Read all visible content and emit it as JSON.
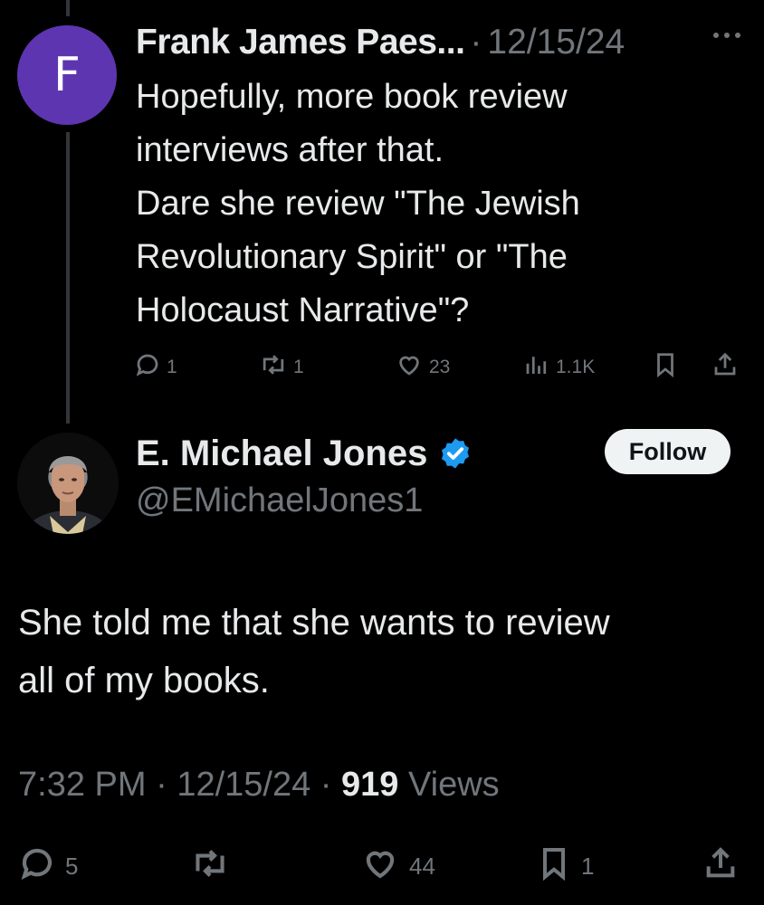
{
  "reply": {
    "avatar_letter": "F",
    "avatar_color": "#5e35b1",
    "author_name": "Frank James Paes...",
    "separator": "·",
    "date": "12/15/24",
    "more_icon": "more-horizontal-icon",
    "body_lines": [
      "Hopefully, more book review",
      "interviews after that.",
      "Dare she review \"The Jewish",
      "Revolutionary Spirit\" or \"The",
      "Holocaust Narrative\"?"
    ],
    "actions": {
      "replies": "1",
      "reposts": "1",
      "likes": "23",
      "views": "1.1K"
    }
  },
  "tweet": {
    "author_name": "E. Michael Jones",
    "verified": true,
    "verified_color": "#1d9bf0",
    "handle": "@EMichaelJones1",
    "follow_label": "Follow",
    "body_lines": [
      "She told me that she wants to review",
      "all of my books."
    ],
    "time": "7:32 PM",
    "sep1": "·",
    "date": "12/15/24",
    "sep2": "·",
    "views_count": "919",
    "views_label": "Views",
    "actions": {
      "replies": "5",
      "reposts": "",
      "likes": "44",
      "bookmarks": "1"
    }
  },
  "colors": {
    "background": "#000000",
    "text_primary": "#e7e9ea",
    "text_secondary": "#71767b",
    "thread_line": "#333639"
  }
}
